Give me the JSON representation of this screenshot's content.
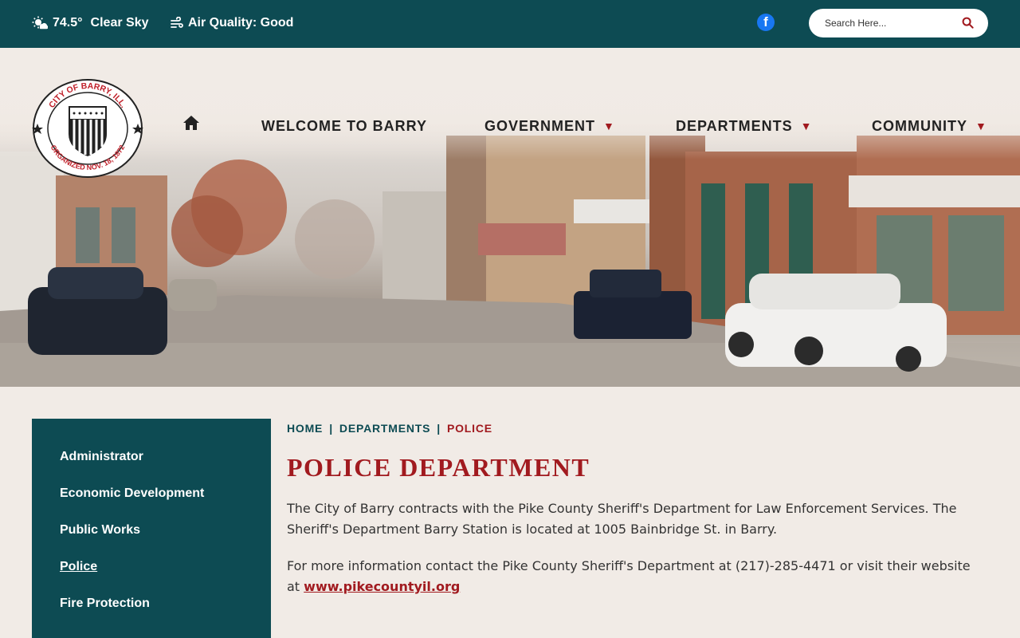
{
  "topbar": {
    "temperature": "74.5°",
    "condition": "Clear Sky",
    "air_quality": "Air Quality: Good",
    "search_placeholder": "Search Here...",
    "facebook_glyph": "f"
  },
  "logo": {
    "top_text": "CITY OF BARRY, ILL.",
    "bottom_text": "ORGANIZED NOV. 18, 1872"
  },
  "nav": {
    "items": [
      {
        "label": "WELCOME TO BARRY",
        "has_dropdown": false
      },
      {
        "label": "GOVERNMENT",
        "has_dropdown": true
      },
      {
        "label": "DEPARTMENTS",
        "has_dropdown": true
      },
      {
        "label": "COMMUNITY",
        "has_dropdown": true
      }
    ],
    "caret": "▼"
  },
  "sidebar": {
    "items": [
      {
        "label": "Administrator"
      },
      {
        "label": "Economic Development"
      },
      {
        "label": "Public Works"
      },
      {
        "label": "Police",
        "active": true
      },
      {
        "label": "Fire Protection"
      }
    ]
  },
  "breadcrumb": {
    "items": [
      "HOME",
      "DEPARTMENTS",
      "POLICE"
    ],
    "separator": "|"
  },
  "content": {
    "title": "POLICE DEPARTMENT",
    "paragraph1": "The City of Barry contracts with the Pike County Sheriff's Department for Law Enforcement Services. The Sheriff's Department Barry Station is located at 1005 Bainbridge St. in Barry.",
    "paragraph2_prefix": "For more information contact the Pike County Sheriff's Department at (217)-285-4471 or visit their website at ",
    "paragraph2_link": "www.pikecountyil.org"
  },
  "colors": {
    "primary": "#0d4b53",
    "accent": "#a11a1f",
    "background": "#f1ebe6"
  }
}
